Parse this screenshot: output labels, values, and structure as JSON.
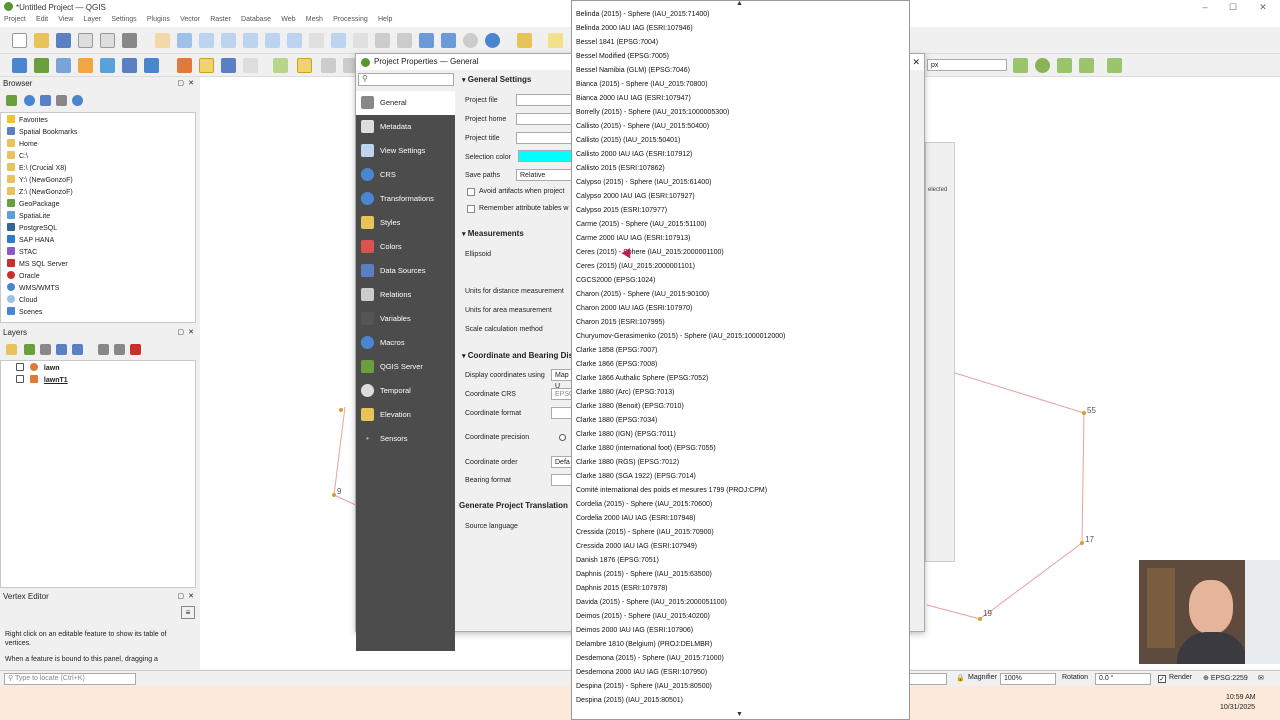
{
  "window": {
    "title": "*Untitled Project — QGIS"
  },
  "menu": [
    "Project",
    "Edit",
    "View",
    "Layer",
    "Settings",
    "Plugins",
    "Vector",
    "Raster",
    "Database",
    "Web",
    "Mesh",
    "Processing",
    "Help"
  ],
  "browser": {
    "title": "Browser",
    "items": [
      "Favorites",
      "Spatial Bookmarks",
      "Home",
      "C:\\",
      "E:\\ (Crucial X8)",
      "Y:\\ (NewGonzoF)",
      "Z:\\ (NewGonzoF)",
      "GeoPackage",
      "SpatiaLite",
      "PostgreSQL",
      "SAP HANA",
      "STAC",
      "MS SQL Server",
      "Oracle",
      "WMS/WMTS",
      "Cloud",
      "Scenes"
    ]
  },
  "layers": {
    "title": "Layers",
    "items": [
      "lawn",
      "lawnT1"
    ]
  },
  "vertex_editor": {
    "title": "Vertex Editor",
    "text1": "Right click on an editable feature to show its table of vertices.",
    "text2": "When a feature is bound to this panel, dragging a"
  },
  "locator": {
    "placeholder": "Type to locate (Ctrl+K)"
  },
  "dialog": {
    "title": "Project Properties — General",
    "sections": [
      "General",
      "Metadata",
      "View Settings",
      "CRS",
      "Transformations",
      "Styles",
      "Colors",
      "Data Sources",
      "Relations",
      "Variables",
      "Macros",
      "QGIS Server",
      "Temporal",
      "Elevation",
      "Sensors"
    ],
    "general_settings": "General Settings",
    "project_file": "Project file",
    "project_home": "Project home",
    "project_title": "Project title",
    "selection_color": "Selection color",
    "save_paths": "Save paths",
    "save_paths_value": "Relative",
    "avoid_artifacts": "Avoid artifacts when project",
    "remember_attr": "Remember attribute tables w",
    "measurements": "Measurements",
    "ellipsoid": "Ellipsoid",
    "units_distance": "Units for distance measurement",
    "units_area": "Units for area measurement",
    "scale_calc": "Scale calculation method",
    "coord_bearing": "Coordinate and Bearing Dis",
    "display_coords": "Display coordinates using",
    "display_coords_value": "Map U",
    "coord_crs": "Coordinate CRS",
    "coord_crs_value": "EPSG",
    "coord_format": "Coordinate format",
    "coord_precision": "Coordinate precision",
    "coord_order": "Coordinate order",
    "coord_order_value": "Defa",
    "bearing_format": "Bearing format",
    "gen_translation": "Generate Project Translation",
    "source_language": "Source language",
    "selection_color_hex": "#00ffff"
  },
  "ellipsoids": [
    "Belinda (2015) - Sphere (IAU_2015:71400)",
    "Belinda 2000 IAU IAG (ESRI:107946)",
    "Bessel 1841 (EPSG:7004)",
    "Bessel Modified (EPSG:7005)",
    "Bessel Namibia (GLM) (EPSG:7046)",
    "Bianca (2015) - Sphere (IAU_2015:70800)",
    "Bianca 2000 IAU IAG (ESRI:107947)",
    "Borrelly (2015) - Sphere (IAU_2015:1000005300)",
    "Callisto (2015) - Sphere (IAU_2015:50400)",
    "Callisto (2015) (IAU_2015:50401)",
    "Callisto 2000 IAU IAG (ESRI:107912)",
    "Callisto 2015 (ESRI:107862)",
    "Calypso (2015) - Sphere (IAU_2015:61400)",
    "Calypso 2000 IAU IAG (ESRI:107927)",
    "Calypso 2015 (ESRI:107977)",
    "Carme (2015) - Sphere (IAU_2015:51100)",
    "Carme 2000 IAU IAG (ESRI:107913)",
    "Ceres (2015) - Sphere (IAU_2015:2000001100)",
    "Ceres (2015) (IAU_2015:2000001101)",
    "CGCS2000 (EPSG:1024)",
    "Charon (2015) - Sphere (IAU_2015:90100)",
    "Charon 2000 IAU IAG (ESRI:107970)",
    "Charon 2015 (ESRI:107995)",
    "Churyumov-Gerasimenko (2015) - Sphere (IAU_2015:1000012000)",
    "Clarke 1858 (EPSG:7007)",
    "Clarke 1866 (EPSG:7008)",
    "Clarke 1866 Authalic Sphere (EPSG:7052)",
    "Clarke 1880 (Arc) (EPSG:7013)",
    "Clarke 1880 (Benoit) (EPSG:7010)",
    "Clarke 1880 (EPSG:7034)",
    "Clarke 1880 (IGN) (EPSG:7011)",
    "Clarke 1880 (international foot) (EPSG:7055)",
    "Clarke 1880 (RGS) (EPSG:7012)",
    "Clarke 1880 (SGA 1922) (EPSG:7014)",
    "Comité international des poids et mesures 1799 (PROJ:CPM)",
    "Cordelia (2015) - Sphere (IAU_2015:70600)",
    "Cordelia 2000 IAU IAG (ESRI:107948)",
    "Cressida (2015) - Sphere (IAU_2015:70900)",
    "Cressida 2000 IAU IAG (ESRI:107949)",
    "Danish 1876 (EPSG:7051)",
    "Daphnis (2015) - Sphere (IAU_2015:63500)",
    "Daphnis 2015 (ESRI:107978)",
    "Davida (2015) - Sphere (IAU_2015:2000051100)",
    "Deimos (2015) - Sphere (IAU_2015:40200)",
    "Deimos 2000 IAU IAG (ESRI:107906)",
    "Delambre 1810 (Belgium) (PROJ:DELMBR)",
    "Desdemona (2015) - Sphere (IAU_2015:71000)",
    "Desdemona 2000 IAU IAG (ESRI:107950)",
    "Despina (2015) - Sphere (IAU_2015:80500)",
    "Despina (2015) (IAU_2015:80501)"
  ],
  "map": {
    "vertex_labels": [
      "55",
      "17",
      "19",
      "9"
    ]
  },
  "status": {
    "scale_unit": "px",
    "magnifier_label": "Magnifier",
    "magnifier": "100%",
    "rotation_label": "Rotation",
    "rotation": "0.0 °",
    "render": "Render",
    "crs": "EPSG:2259",
    "selected": "elected"
  },
  "clock": {
    "time": "10:59 AM",
    "date": "10/31/2025"
  }
}
